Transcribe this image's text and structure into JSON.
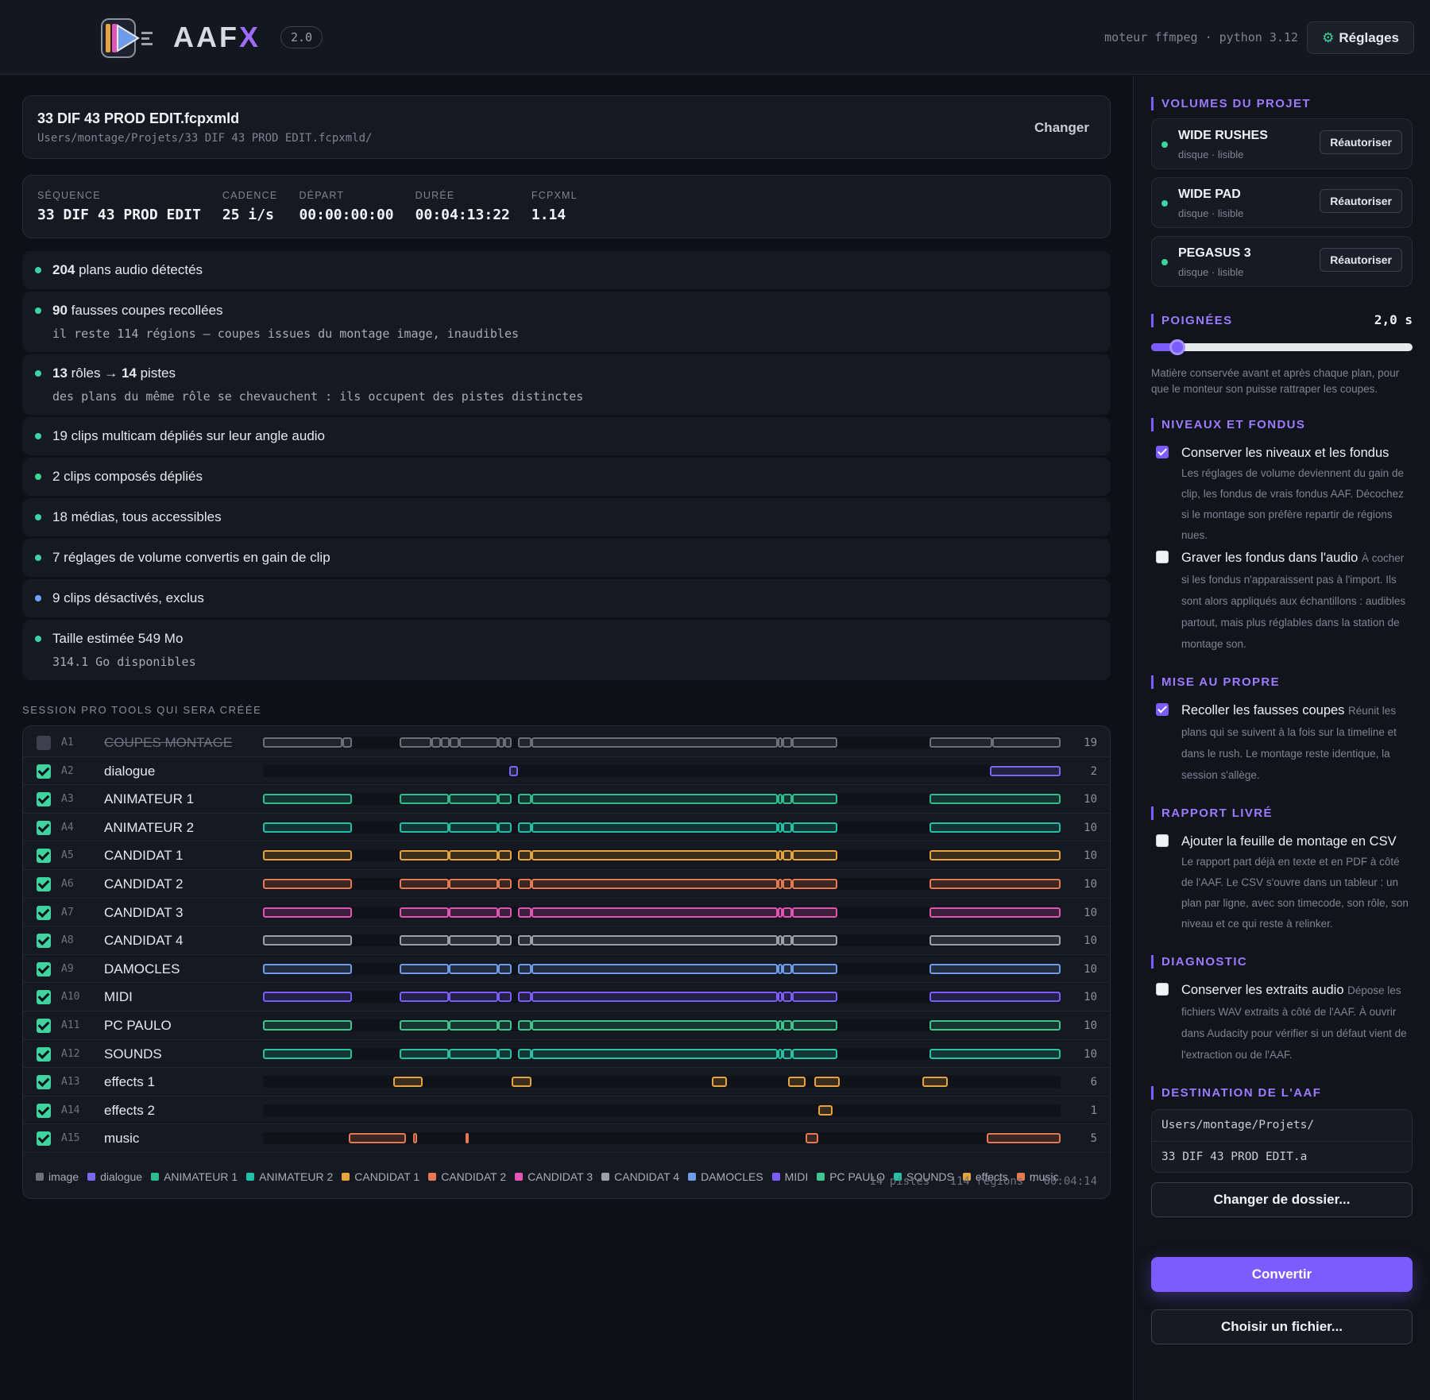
{
  "app": {
    "brand": "AAF",
    "brand_x": "X",
    "version": "2.0",
    "engine": "moteur ffmpeg · python 3.12",
    "settings_label": "Réglages"
  },
  "file": {
    "name": "33 DIF 43 PROD EDIT.fcpxmld",
    "path": "Users/montage/Projets/33 DIF 43 PROD EDIT.fcpxmld/",
    "change_label": "Changer"
  },
  "sequence": [
    {
      "label": "SÉQUENCE",
      "value": "33 DIF 43 PROD EDIT"
    },
    {
      "label": "CADENCE",
      "value": "25 i/s"
    },
    {
      "label": "DÉPART",
      "value": "00:00:00:00"
    },
    {
      "label": "DURÉE",
      "value": "00:04:13:22"
    },
    {
      "label": "FCPXML",
      "value": "1.14"
    }
  ],
  "checks": [
    {
      "bold": "204",
      "text": " plans audio détectés",
      "sub": "",
      "status": "ok"
    },
    {
      "bold": "90",
      "text": " fausses coupes recollées",
      "sub": "il reste 114 régions — coupes issues du montage image, inaudibles",
      "status": "ok"
    },
    {
      "bold": "13",
      "text": " rôles → ",
      "bold2": "14",
      "text2": " pistes",
      "sub": "des plans du même rôle se chevauchent : ils occupent des pistes distinctes",
      "status": "ok"
    },
    {
      "bold": "",
      "text": "19 clips multicam dépliés sur leur angle audio",
      "sub": "",
      "status": "ok"
    },
    {
      "bold": "",
      "text": "2 clips composés dépliés",
      "sub": "",
      "status": "ok"
    },
    {
      "bold": "",
      "text": "18 médias, tous accessibles",
      "sub": "",
      "status": "ok"
    },
    {
      "bold": "",
      "text": "7 réglages de volume convertis en gain de clip",
      "sub": "",
      "status": "ok"
    },
    {
      "bold": "",
      "text": "9 clips désactivés, exclus",
      "sub": "",
      "status": "info"
    },
    {
      "bold": "",
      "text": "Taille estimée 549 Mo",
      "sub": "314.1 Go disponibles",
      "status": "ok"
    }
  ],
  "session_label": "SESSION PRO TOOLS QUI SERA CRÉÉE",
  "colors": {
    "image": "#6b7079",
    "dialogue": "#7b68ee",
    "anim1": "#2ebd8f",
    "anim2": "#22c0a8",
    "cand1": "#e8a33d",
    "cand2": "#e57a52",
    "cand3": "#e255b4",
    "cand4": "#9aa1ad",
    "damocles": "#6e9ce8",
    "midi": "#7b5cff",
    "pcpaulo": "#3fc58e",
    "sounds": "#25c2a6",
    "effects": "#e8a33d",
    "music": "#e57a52",
    "accent": "#7b5cff",
    "ok": "#3fd3a0"
  },
  "tracks": [
    {
      "id": "A1",
      "name": "COUPES MONTAGE",
      "count": "19",
      "enabled": false,
      "color": "image",
      "pattern": "full"
    },
    {
      "id": "A2",
      "name": "dialogue",
      "count": "2",
      "enabled": true,
      "color": "dialogue",
      "pattern": "dialogue"
    },
    {
      "id": "A3",
      "name": "ANIMATEUR 1",
      "count": "10",
      "enabled": true,
      "color": "anim1",
      "pattern": "ten"
    },
    {
      "id": "A4",
      "name": "ANIMATEUR 2",
      "count": "10",
      "enabled": true,
      "color": "anim2",
      "pattern": "ten"
    },
    {
      "id": "A5",
      "name": "CANDIDAT 1",
      "count": "10",
      "enabled": true,
      "color": "cand1",
      "pattern": "ten"
    },
    {
      "id": "A6",
      "name": "CANDIDAT 2",
      "count": "10",
      "enabled": true,
      "color": "cand2",
      "pattern": "ten"
    },
    {
      "id": "A7",
      "name": "CANDIDAT 3",
      "count": "10",
      "enabled": true,
      "color": "cand3",
      "pattern": "ten"
    },
    {
      "id": "A8",
      "name": "CANDIDAT 4",
      "count": "10",
      "enabled": true,
      "color": "cand4",
      "pattern": "ten"
    },
    {
      "id": "A9",
      "name": "DAMOCLES",
      "count": "10",
      "enabled": true,
      "color": "damocles",
      "pattern": "ten"
    },
    {
      "id": "A10",
      "name": "MIDI",
      "count": "10",
      "enabled": true,
      "color": "midi",
      "pattern": "ten"
    },
    {
      "id": "A11",
      "name": "PC PAULO",
      "count": "10",
      "enabled": true,
      "color": "pcpaulo",
      "pattern": "ten"
    },
    {
      "id": "A12",
      "name": "SOUNDS",
      "count": "10",
      "enabled": true,
      "color": "sounds",
      "pattern": "ten"
    },
    {
      "id": "A13",
      "name": "effects 1",
      "count": "6",
      "enabled": true,
      "color": "effects",
      "pattern": "fx1"
    },
    {
      "id": "A14",
      "name": "effects 2",
      "count": "1",
      "enabled": true,
      "color": "effects",
      "pattern": "fx2"
    },
    {
      "id": "A15",
      "name": "music",
      "count": "5",
      "enabled": true,
      "color": "music",
      "pattern": "music"
    }
  ],
  "legend": [
    {
      "label": "image",
      "color": "image"
    },
    {
      "label": "dialogue",
      "color": "dialogue"
    },
    {
      "label": "ANIMATEUR 1",
      "color": "anim1"
    },
    {
      "label": "ANIMATEUR 2",
      "color": "anim2"
    },
    {
      "label": "CANDIDAT 1",
      "color": "cand1"
    },
    {
      "label": "CANDIDAT 2",
      "color": "cand2"
    },
    {
      "label": "CANDIDAT 3",
      "color": "cand3"
    },
    {
      "label": "CANDIDAT 4",
      "color": "cand4"
    },
    {
      "label": "DAMOCLES",
      "color": "damocles"
    },
    {
      "label": "MIDI",
      "color": "midi"
    },
    {
      "label": "PC PAULO",
      "color": "pcpaulo"
    },
    {
      "label": "SOUNDS",
      "color": "sounds"
    },
    {
      "label": "effects",
      "color": "effects"
    },
    {
      "label": "music",
      "color": "music"
    }
  ],
  "summary": "14 pistes · 114 régions · 00:04:14",
  "side": {
    "volumes_title": "VOLUMES DU PROJET",
    "volumes": [
      {
        "name": "WIDE RUSHES",
        "status": "disque · lisible",
        "action": "Réautoriser"
      },
      {
        "name": "WIDE PAD",
        "status": "disque · lisible",
        "action": "Réautoriser"
      },
      {
        "name": "PEGASUS 3",
        "status": "disque · lisible",
        "action": "Réautoriser"
      }
    ],
    "handles_title": "POIGNÉES",
    "handles_value": "2,0 s",
    "handles_fraction": 0.1,
    "handles_help": "Matière conservée avant et après chaque plan, pour que le monteur son puisse rattraper les coupes.",
    "levels_title": "NIVEAUX ET FONDUS",
    "opt_levels": {
      "label": "Conserver les niveaux et les fondus",
      "desc": "Les réglages de volume deviennent du gain de clip, les fondus de vrais fondus AAF. Décochez si le montage son préfère repartir de régions nues.",
      "checked": true
    },
    "opt_burn": {
      "label": "Graver les fondus dans l'audio",
      "desc": "À cocher si les fondus n'apparaissent pas à l'import. Ils sont alors appliqués aux échantillons : audibles partout, mais plus réglables dans la station de montage son.",
      "checked": false
    },
    "cleanup_title": "MISE AU PROPRE",
    "opt_glue": {
      "label": "Recoller les fausses coupes",
      "desc": "Réunit les plans qui se suivent à la fois sur la timeline et dans le rush. Le montage reste identique, la session s'allège.",
      "checked": true
    },
    "report_title": "RAPPORT LIVRÉ",
    "opt_csv": {
      "label": "Ajouter la feuille de montage en CSV",
      "desc": "Le rapport part déjà en texte et en PDF à côté de l'AAF. Le CSV s'ouvre dans un tableur : un plan par ligne, avec son timecode, son rôle, son niveau et ce qui reste à relinker.",
      "checked": false
    },
    "diag_title": "DIAGNOSTIC",
    "opt_extract": {
      "label": "Conserver les extraits audio",
      "desc": "Dépose les fichiers WAV extraits à côté de l'AAF. À ouvrir dans Audacity pour vérifier si un défaut vient de l'extraction ou de l'AAF.",
      "checked": false
    },
    "dest_title": "DESTINATION DE L'AAF",
    "dest_dir": "Users/montage/Projets/",
    "dest_file": "33 DIF 43 PROD EDIT.a",
    "change_dir": "Changer de dossier...",
    "convert": "Convertir",
    "choose_file": "Choisir un fichier..."
  }
}
